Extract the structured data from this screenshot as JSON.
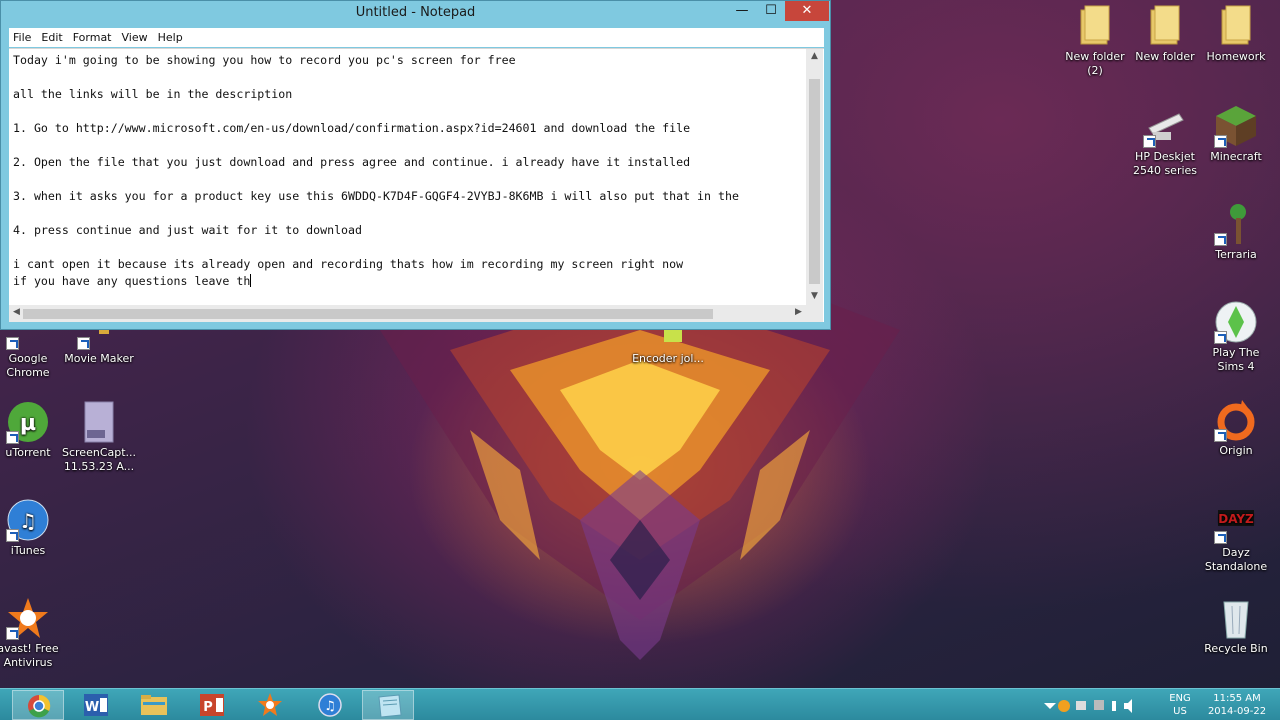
{
  "notepad": {
    "title": "Untitled - Notepad",
    "buttons": {
      "minimize": "—",
      "maximize": "☐",
      "close": "✕"
    },
    "menu": [
      "File",
      "Edit",
      "Format",
      "View",
      "Help"
    ],
    "lines": [
      "Today i'm going to be showing you how to record you pc's screen for free",
      "all the links will be in the description",
      "1. Go to http://www.microsoft.com/en-us/download/confirmation.aspx?id=24601 and download the file",
      "2. Open the file that you just download and press agree and continue. i already have it installed",
      "3. when it asks you for a product key use this 6WDDQ-K7D4F-GQGF4-2VYBJ-8K6MB i will also put that in the",
      "4. press continue and just wait for it to download",
      "i cant open it because its already open and recording thats how im recording my screen right now",
      "if you have any questions leave th"
    ]
  },
  "desktop_icons": {
    "new_folder_2": "New folder\n(2)",
    "new_folder": "New folder",
    "homework": "Homework",
    "hp_deskjet": "HP Deskjet\n2540 series",
    "minecraft": "Minecraft",
    "terraria": "Terraria",
    "google_chrome": "Google\nChrome",
    "movie_maker": "Movie Maker",
    "encoder": "Encoder jol...",
    "play_sims": "Play The\nSims 4",
    "utorrent": "uTorrent",
    "screencapture": "ScreenCapt...\n11.53.23 A...",
    "origin": "Origin",
    "itunes": "iTunes",
    "dayz": "Dayz\nStandalone",
    "avast": "avast! Free\nAntivirus",
    "recycle_bin": "Recycle Bin"
  },
  "taskbar": {
    "apps": [
      "chrome",
      "word",
      "file-explorer",
      "powerpoint",
      "avast",
      "itunes",
      "notepad"
    ],
    "language": "ENG",
    "region": "US",
    "time": "11:55 AM",
    "date": "2014-09-22"
  },
  "colors": {
    "window_frame": "#7fc9e0",
    "close_button": "#c7463b",
    "taskbar": "#2c8a9e"
  }
}
